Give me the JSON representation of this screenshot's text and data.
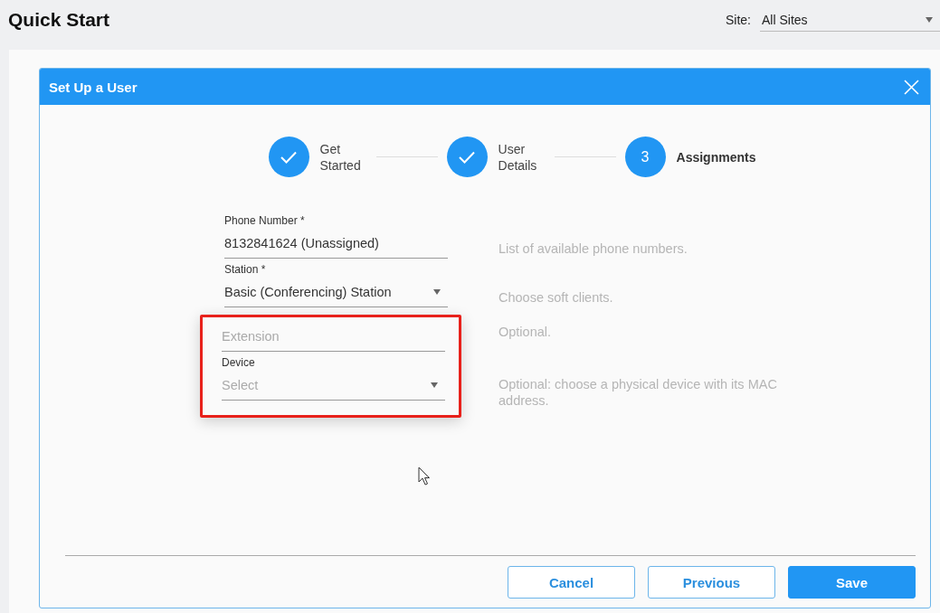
{
  "page": {
    "title": "Quick Start",
    "site": {
      "label": "Site:",
      "value": "All Sites"
    }
  },
  "dialog": {
    "title": "Set Up a User",
    "steps": [
      {
        "label": "Get Started",
        "completed": true
      },
      {
        "label": "User Details",
        "completed": true
      },
      {
        "label": "Assignments",
        "completed": false,
        "number": "3"
      }
    ],
    "fields": [
      {
        "kind": "text",
        "label": "Phone Number *",
        "value": "8132841624 (Unassigned)",
        "hint": "List of available phone numbers.",
        "highlighted": false
      },
      {
        "kind": "select",
        "label": "Station *",
        "value": "Basic (Conferencing) Station",
        "hint": "Choose soft clients.",
        "highlighted": false
      },
      {
        "kind": "text",
        "placeholder": "Extension",
        "hint": "Optional.",
        "highlighted": true
      },
      {
        "kind": "select",
        "label": "Device",
        "placeholder": "Select",
        "hint": "Optional: choose a physical device with its MAC address.",
        "highlighted": true
      }
    ],
    "buttons": [
      {
        "label": "Cancel",
        "kind": "outline"
      },
      {
        "label": "Previous",
        "kind": "outline"
      },
      {
        "label": "Save",
        "kind": "primary"
      }
    ]
  }
}
